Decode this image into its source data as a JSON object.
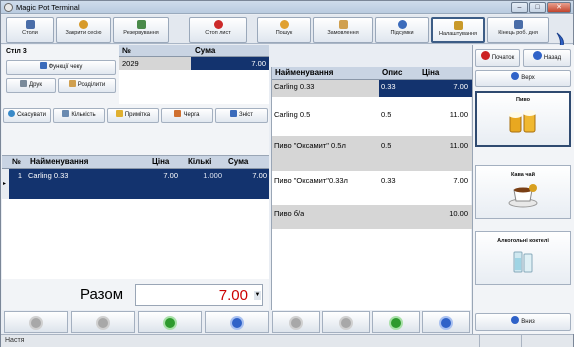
{
  "window": {
    "title": "Magic Pot Terminal",
    "min": "–",
    "max": "□",
    "close": "✕"
  },
  "toolbar": [
    {
      "name": "tables",
      "label": "Столи",
      "icon_color": "#4a6da8"
    },
    {
      "name": "close-session",
      "label": "Закрити сесію",
      "icon_color": "#d79a2a"
    },
    {
      "name": "reservation",
      "label": "Резервування",
      "icon_color": "#4a8a4a"
    },
    {
      "name": "stop-list",
      "label": "Стоп лист",
      "icon_color": "#cc2a2a"
    },
    {
      "name": "search",
      "label": "Пошук",
      "icon_color": "#e0a030"
    },
    {
      "name": "orders",
      "label": "Замовлення",
      "icon_color": "#d0a050"
    },
    {
      "name": "subtotals",
      "label": "Підсумки",
      "icon_color": "#3b6bbb"
    },
    {
      "name": "settings",
      "label": "Налаштування",
      "icon_color": "#c99a2a"
    },
    {
      "name": "end-day",
      "label": "Кінець роб. дня",
      "icon_color": "#4a6da8"
    }
  ],
  "left": {
    "table_label": "Стіл 3",
    "col_no": "№",
    "col_sum": "Сума",
    "check_no": "2029",
    "check_sum": "7.00",
    "btn_check_functions": "Функції чеку",
    "btn_print": "Друк",
    "btn_split": "Розділити",
    "btn_cancel": "Скасувати",
    "btn_quantity": "Кількість",
    "btn_note": "Примітка",
    "btn_queue": "Черга",
    "btn_discount": "Зніст"
  },
  "order": {
    "headers": {
      "no": "№",
      "name": "Найменування",
      "price": "Ціна",
      "qty": "Кількі",
      "sum": "Сума"
    },
    "rows": [
      {
        "no": "1",
        "name": "Carling 0.33",
        "price": "7.00",
        "qty": "1.000",
        "sum": "7.00"
      }
    ]
  },
  "total": {
    "label": "Разом",
    "value": "7.00"
  },
  "menu": {
    "headers": {
      "name": "Найменування",
      "desc": "Опис",
      "price": "Ціна"
    },
    "rows": [
      {
        "name": "Carling 0.33",
        "desc": "0.33",
        "price": "7.00"
      },
      {
        "name": "Carling 0.5",
        "desc": "0.5",
        "price": "11.00"
      },
      {
        "name": "Пиво \"Оксамит\" 0.5л",
        "desc": "0.5",
        "price": "11.00"
      },
      {
        "name": "Пиво \"Оксамит\"0.33л",
        "desc": "0.33",
        "price": "7.00"
      },
      {
        "name": "Пиво б/а",
        "desc": "",
        "price": "10.00"
      }
    ]
  },
  "right": {
    "btn_start": "Початок",
    "btn_back": "Назад",
    "btn_up": "Верх",
    "btn_down": "Вниз",
    "categories": [
      {
        "label": "Пиво",
        "icon": "beer-icon"
      },
      {
        "label": "Кава чай",
        "icon": "coffee-icon"
      },
      {
        "label": "Алкогольні коктелі",
        "icon": "cocktail-icon"
      }
    ]
  },
  "status": {
    "text": "Настя"
  },
  "colors": {
    "selection": "#13336e",
    "accent_red": "#cc0000",
    "nav_green": "#2e9a2e",
    "nav_blue": "#2f62c8",
    "nav_grey": "#9a9a9a"
  }
}
